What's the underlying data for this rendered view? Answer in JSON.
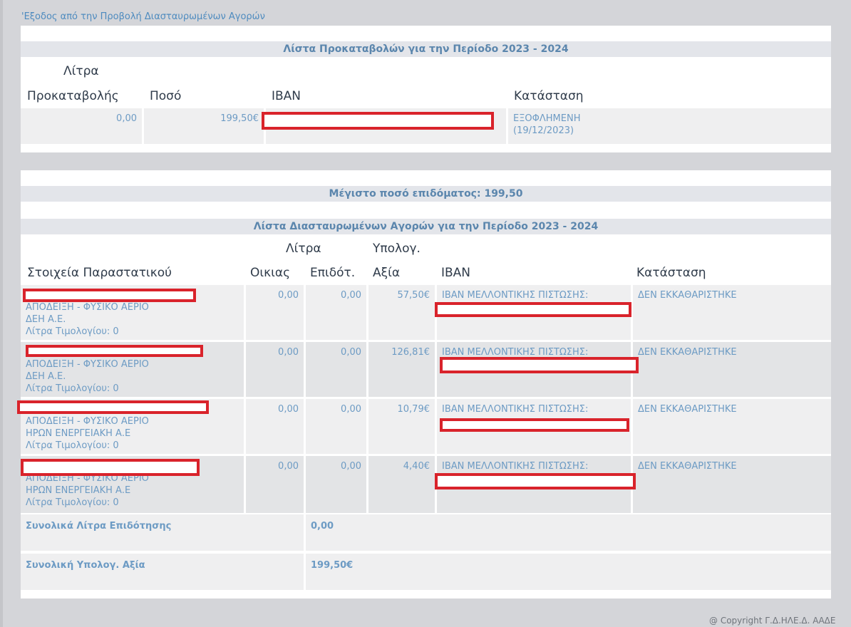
{
  "exit_link": "'Εξοδος από την Προβολή Διασταυρωμένων Αγορών",
  "advances": {
    "title": "Λίστα Προκαταβολών για την Περίοδο 2023 - 2024",
    "headers": {
      "litres_top": "Λίτρα",
      "litres_bottom": "Προκαταβολής",
      "amount": "Ποσό",
      "iban": "IBAN",
      "status": "Κατάσταση"
    },
    "row": {
      "litres": "0,00",
      "amount": "199,50€",
      "status_line1": "ΕΞΟΦΛΗΜΕΝΗ",
      "status_line2": "(19/12/2023)"
    }
  },
  "max_amount": "Μέγιστο ποσό επιδόματος: 199,50",
  "purchases": {
    "title": "Λίστα Διασταυρωμένων Αγορών για την Περίοδο 2023 - 2024",
    "headers": {
      "document": "Στοιχεία Παραστατικού",
      "household": "Οικιας",
      "litres_top": "Λίτρα",
      "subsidised": "Επιδότ.",
      "calc_top": "Υπολογ.",
      "value": "Αξία",
      "iban": "IBAN",
      "status": "Κατάσταση"
    },
    "rows": [
      {
        "type": "ΑΠΟΔΕΙΞΗ - ΦΥΣΙΚΟ ΑΕΡΙΟ",
        "vendor": "ΔΕΗ Α.Ε.",
        "invoice_litres": "Λίτρα Τιμολογίου: 0",
        "household": "0,00",
        "subsidised": "0,00",
        "value": "57,50€",
        "iban_label": "IBAN ΜΕΛΛΟΝΤΙΚΗΣ ΠΙΣΤΩΣΗΣ:",
        "status": "ΔΕΝ ΕΚΚΑΘΑΡΙΣΤΗΚΕ"
      },
      {
        "type": "ΑΠΟΔΕΙΞΗ - ΦΥΣΙΚΟ ΑΕΡΙΟ",
        "vendor": "ΔΕΗ Α.Ε.",
        "invoice_litres": "Λίτρα Τιμολογίου: 0",
        "household": "0,00",
        "subsidised": "0,00",
        "value": "126,81€",
        "iban_label": "IBAN ΜΕΛΛΟΝΤΙΚΗΣ ΠΙΣΤΩΣΗΣ:",
        "status": "ΔΕΝ ΕΚΚΑΘΑΡΙΣΤΗΚΕ"
      },
      {
        "type": "ΑΠΟΔΕΙΞΗ - ΦΥΣΙΚΟ ΑΕΡΙΟ",
        "vendor": "ΗΡΩΝ ΕΝΕΡΓΕΙΑΚΗ Α.Ε",
        "invoice_litres": "Λίτρα Τιμολογίου: 0",
        "household": "0,00",
        "subsidised": "0,00",
        "value": "10,79€",
        "iban_label": "IBAN ΜΕΛΛΟΝΤΙΚΗΣ ΠΙΣΤΩΣΗΣ:",
        "status": "ΔΕΝ ΕΚΚΑΘΑΡΙΣΤΗΚΕ"
      },
      {
        "type": "ΑΠΟΔΕΙΞΗ - ΦΥΣΙΚΟ ΑΕΡΙΟ",
        "vendor": "ΗΡΩΝ ΕΝΕΡΓΕΙΑΚΗ Α.Ε",
        "invoice_litres": "Λίτρα Τιμολογίου: 0",
        "household": "0,00",
        "subsidised": "0,00",
        "value": "4,40€",
        "iban_label": "IBAN ΜΕΛΛΟΝΤΙΚΗΣ ΠΙΣΤΩΣΗΣ:",
        "status": "ΔΕΝ ΕΚΚΑΘΑΡΙΣΤΗΚΕ"
      }
    ],
    "totals": {
      "litres_label": "Συνολικά Λίτρα Επιδότησης",
      "litres_value": "0,00",
      "value_label": "Συνολική Υπολογ. Αξία",
      "value_value": "199,50€"
    }
  },
  "footer": {
    "copyright": "@ Copyright Γ.Δ.ΗΛΕ.Δ. ΑΑΔΕ"
  }
}
